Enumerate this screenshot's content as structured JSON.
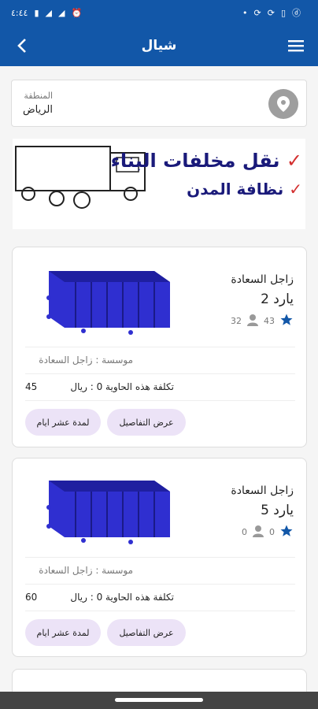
{
  "status_bar": {
    "time": "٤:٤٤",
    "left_icons": [
      "battery-icon",
      "signal-icon",
      "wifi-icon",
      "alarm-icon"
    ],
    "right_icons": [
      "dot-icon",
      "sync-icon",
      "sync-icon",
      "file-icon",
      "d-icon"
    ]
  },
  "appbar": {
    "title": "شيال"
  },
  "region": {
    "label": "المنطقة",
    "value": "الرياض"
  },
  "banner": {
    "line1": "نقل مخلفات البناء",
    "line2": "نظافة المدن"
  },
  "cards": [
    {
      "title": "زاجل السعادة",
      "size": "2 يارد",
      "rating": "43",
      "users": "32",
      "org": "موسسة : زاجل السعادة",
      "cost": "تكلفة هذه الحاوية 0 : ريال",
      "price": "45",
      "details_label": "عرض التفاصيل",
      "duration_label": "لمدة عشر ايام"
    },
    {
      "title": "زاجل السعادة",
      "size": "5 يارد",
      "rating": "0",
      "users": "0",
      "org": "موسسة : زاجل السعادة",
      "cost": "تكلفة هذه الحاوية 0 : ريال",
      "price": "60",
      "details_label": "عرض التفاصيل",
      "duration_label": "لمدة عشر ايام"
    }
  ],
  "colors": {
    "primary": "#1257a8",
    "container": "#2f2fd0",
    "pill": "#ece3f7",
    "star": "#1257a8"
  }
}
